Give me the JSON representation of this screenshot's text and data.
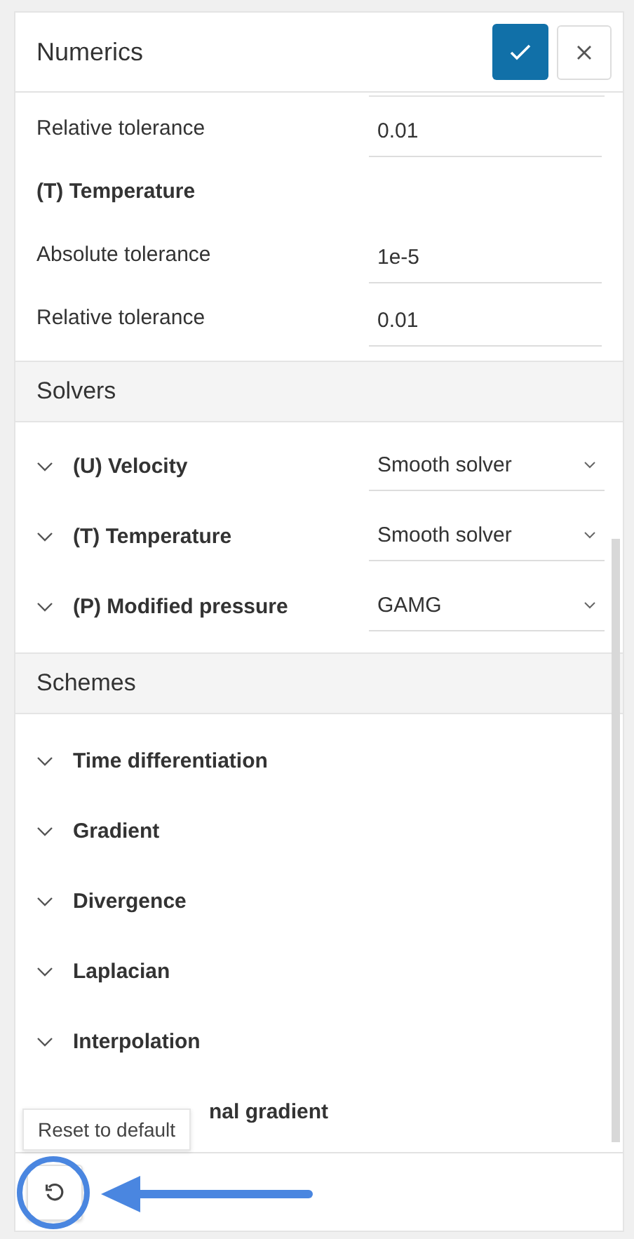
{
  "panel": {
    "title": "Numerics"
  },
  "tolerance_rows": [
    {
      "kind": "field",
      "label": "Relative tolerance",
      "value": "0.01"
    },
    {
      "kind": "heading",
      "label": "(T) Temperature"
    },
    {
      "kind": "field",
      "label": "Absolute tolerance",
      "value": "1e-5"
    },
    {
      "kind": "field",
      "label": "Relative tolerance",
      "value": "0.01"
    }
  ],
  "solvers": {
    "title": "Solvers",
    "items": [
      {
        "label": "(U) Velocity",
        "value": "Smooth solver"
      },
      {
        "label": "(T) Temperature",
        "value": "Smooth solver"
      },
      {
        "label": "(P) Modified pressure",
        "value": "GAMG"
      }
    ]
  },
  "schemes": {
    "title": "Schemes",
    "items": [
      {
        "label": "Time differentiation"
      },
      {
        "label": "Gradient"
      },
      {
        "label": "Divergence"
      },
      {
        "label": "Laplacian"
      },
      {
        "label": "Interpolation"
      },
      {
        "label": "nal gradient",
        "kind": "covered"
      }
    ]
  },
  "tooltip": {
    "text": "Reset to default"
  }
}
